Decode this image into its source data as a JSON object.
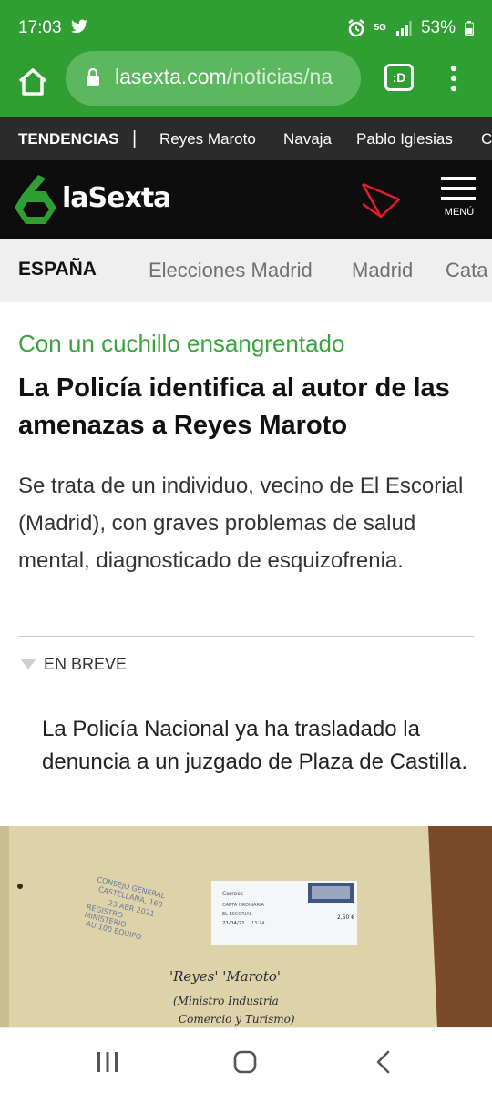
{
  "status_bar": {
    "time": "17:03",
    "network": "5G",
    "battery": "53%"
  },
  "browser": {
    "url_host": "lasexta.com",
    "url_path": "/noticias/na",
    "tab_button_label": ":D"
  },
  "trending": {
    "label": "TENDENCIAS",
    "separator": "|",
    "items": [
      "Reyes Maroto",
      "Navaja",
      "Pablo Iglesias",
      "C"
    ]
  },
  "header": {
    "logo_text": "laSexta",
    "menu_label": "MENÚ",
    "colors": {
      "logo_green": "#2f9f33",
      "header_bg": "#0d0d0d",
      "play_red": "#e11d2a"
    }
  },
  "section_nav": {
    "current": "ESPAÑA",
    "links": [
      "Elecciones Madrid",
      "Madrid",
      "Cata"
    ]
  },
  "article": {
    "kicker": "Con un cuchillo ensangrentado",
    "headline": "La Policía identifica al autor de las amenazas a Reyes Maroto",
    "summary": "Se trata de un individuo, vecino de El Escorial (Madrid), con graves problemas de salud mental, diagnosticado de esquizofrenia.",
    "brief_label": "EN BREVE",
    "brief_text": "La Policía Nacional ya ha trasladado la denuncia a un juzgado de Plaza de Castilla."
  },
  "photo": {
    "stamp_lines": [
      "CONSEJO GENERAL",
      "CASTELLANA, 160",
      "23 ABR 2021",
      "REGISTRO",
      "MINISTERIO",
      "AU 100 EQUIPO"
    ],
    "label_lines": [
      "Correos",
      "CARTA ORDINARIA",
      "EL ESCORIAL",
      "21/04/21",
      "13:24",
      "2,50 €"
    ],
    "handwriting_lines": [
      "'Reyes' 'Maroto'",
      "(Ministro Industria",
      "Comercio y Turismo)"
    ]
  },
  "icons": {
    "home": "home-icon",
    "lock": "lock-icon",
    "more": "more-vert-icon",
    "menu": "hamburger-icon",
    "brief": "triangle-down-icon"
  }
}
